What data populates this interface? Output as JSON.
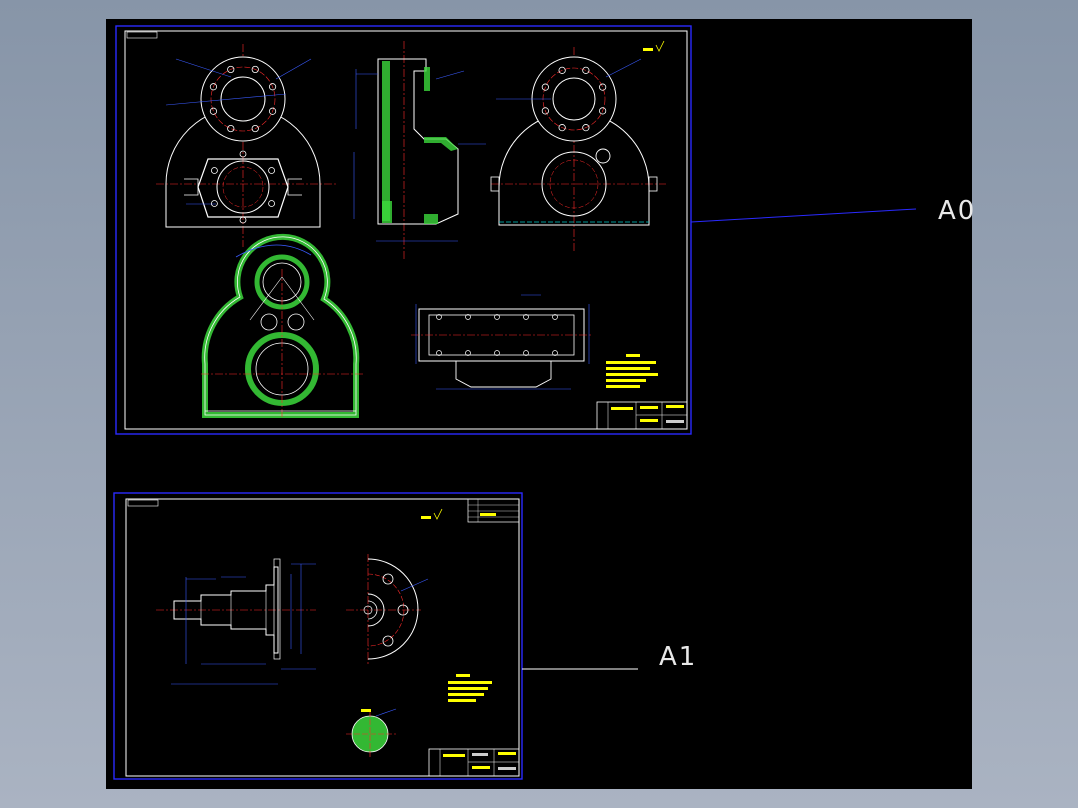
{
  "sheets": {
    "a0": {
      "label": "A0"
    },
    "a1": {
      "label": "A1"
    }
  },
  "colors": {
    "background": "#000000",
    "frame": "#2a2aff",
    "outline": "#ffffff",
    "centerline": "#ff2b2b",
    "dimension": "#3a5bff",
    "hatch": "#3cd83c",
    "note": "#ffff00",
    "leader": "#00c8c8"
  },
  "icons": {
    "roughness": "roughness-symbol-icon"
  }
}
